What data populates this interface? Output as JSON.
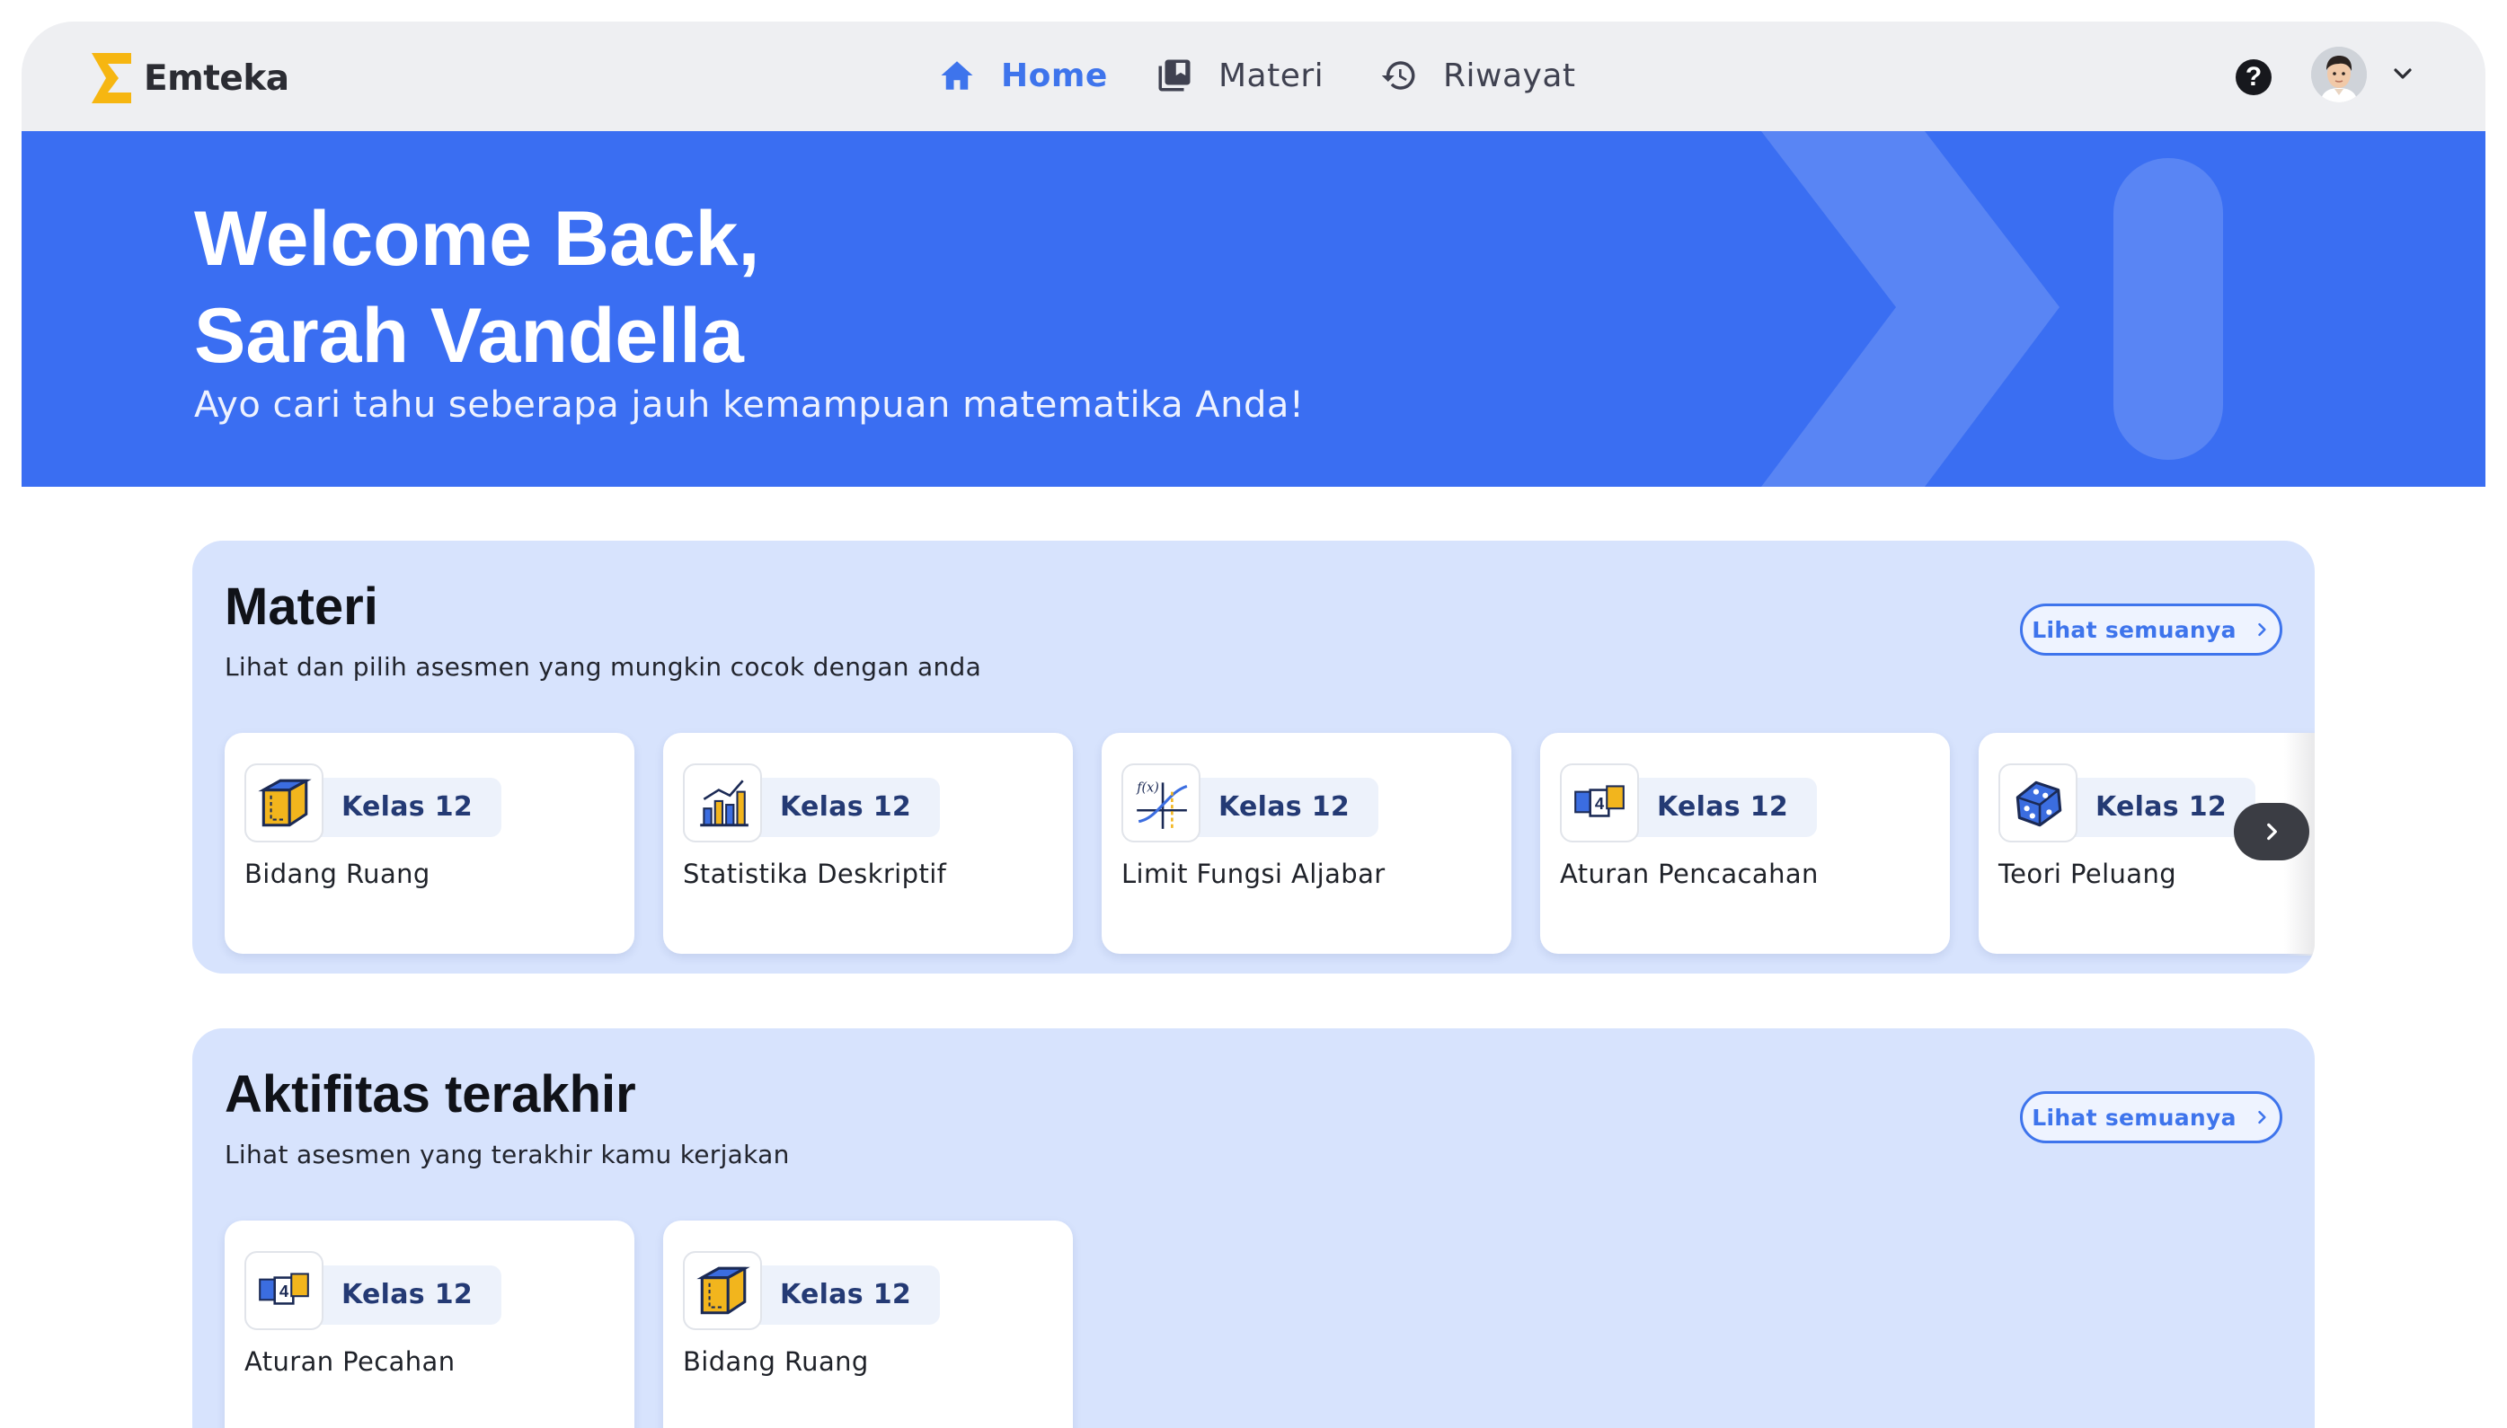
{
  "brand": {
    "name": "Emteka",
    "logo_color": "#f6b611"
  },
  "nav": {
    "items": [
      {
        "label": "Home",
        "icon": "home-icon",
        "active": true
      },
      {
        "label": "Materi",
        "icon": "library-books-icon",
        "active": false
      },
      {
        "label": "Riwayat",
        "icon": "history-icon",
        "active": false
      }
    ],
    "help_icon": "help-icon",
    "avatar_icon": "user-avatar",
    "menu_icon": "chevron-down-icon"
  },
  "hero": {
    "title_line1": "Welcome Back,",
    "title_line2": "Sarah Vandella",
    "subtitle": "Ayo cari tahu seberapa jauh kemampuan matematika Anda!",
    "background_color": "#3a6ef2"
  },
  "materi": {
    "title": "Materi",
    "subtitle": "Lihat dan pilih asesmen  yang mungkin cocok dengan anda",
    "see_all_label": "Lihat semuanya",
    "cards": [
      {
        "badge": "Kelas 12",
        "title": "Bidang Ruang",
        "icon": "cube-icon"
      },
      {
        "badge": "Kelas 12",
        "title": "Statistika Deskriptif",
        "icon": "bar-chart-icon"
      },
      {
        "badge": "Kelas 12",
        "title": "Limit Fungsi Aljabar",
        "icon": "function-graph-icon"
      },
      {
        "badge": "Kelas 12",
        "title": "Aturan Pencacahan",
        "icon": "counting-blocks-icon"
      },
      {
        "badge": "Kelas 12",
        "title": "Teori Peluang",
        "icon": "dice-icon"
      }
    ],
    "next_icon": "chevron-right-icon"
  },
  "aktivitas": {
    "title": "Aktifitas terakhir",
    "subtitle": "Lihat asesmen  yang terakhir kamu kerjakan",
    "see_all_label": "Lihat semuanya",
    "cards": [
      {
        "badge": "Kelas 12",
        "title": "Aturan Pecahan",
        "icon": "counting-blocks-icon"
      },
      {
        "badge": "Kelas 12",
        "title": "Bidang Ruang",
        "icon": "cube-icon"
      }
    ]
  },
  "colors": {
    "accent": "#3e74ec",
    "panel_bg": "#d7e3fd",
    "badge_text": "#243a74"
  }
}
